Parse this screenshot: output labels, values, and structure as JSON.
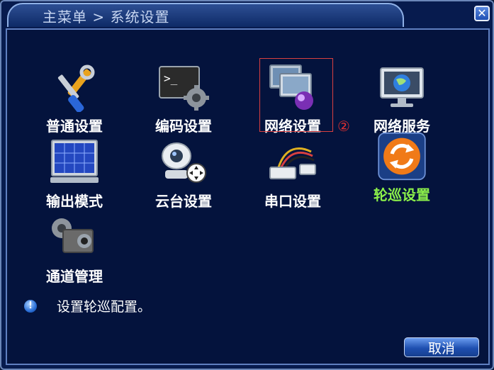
{
  "window": {
    "title": "主菜单 > 系统设置",
    "close_glyph": "✕"
  },
  "menu": {
    "items": [
      {
        "label": "普通设置",
        "icon": "wrench-screwdriver-icon"
      },
      {
        "label": "编码设置",
        "icon": "terminal-gear-icon"
      },
      {
        "label": "网络设置",
        "icon": "network-computers-icon"
      },
      {
        "label": "网络服务",
        "icon": "globe-monitor-icon"
      },
      {
        "label": "输出模式",
        "icon": "grid-monitor-icon"
      },
      {
        "label": "云台设置",
        "icon": "ptz-camera-icon"
      },
      {
        "label": "串口设置",
        "icon": "serial-cable-icon"
      },
      {
        "label": "轮巡设置",
        "icon": "refresh-icon"
      },
      {
        "label": "通道管理",
        "icon": "camera-channel-icon"
      }
    ],
    "active_item": "轮巡设置",
    "outlined_item": "网络设置"
  },
  "annotation": {
    "step_mark": "②"
  },
  "hint": {
    "icon_glyph": "!",
    "text": "设置轮巡配置。"
  },
  "footer": {
    "cancel_label": "取消"
  },
  "colors": {
    "active_label": "#8cf04a",
    "label": "#ffffff",
    "annotation": "#e03030",
    "background": "#04133d"
  }
}
